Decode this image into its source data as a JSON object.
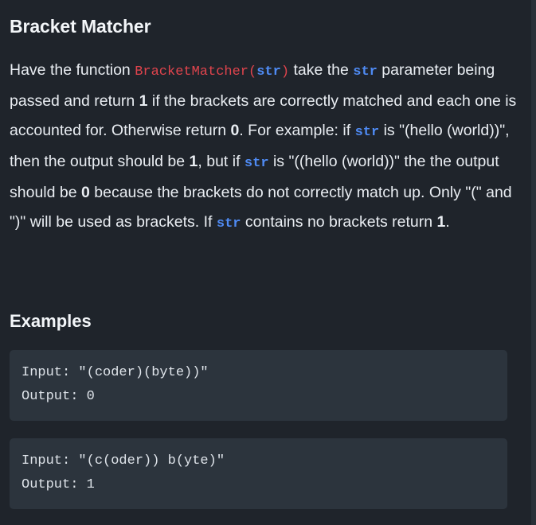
{
  "title": "Bracket Matcher",
  "description": {
    "t1": "Have the function ",
    "fn_name": "BracketMatcher",
    "paren_open": "(",
    "fn_arg": "str",
    "paren_close": ")",
    "t2": " take the ",
    "str1": "str",
    "t3": " parameter being passed and return ",
    "one1": "1",
    "t4": " if the brackets are correctly matched and each one is accounted for. Otherwise return ",
    "zero1": "0",
    "t5": ". For example: if ",
    "str2": "str",
    "t6": " is \"(hello (world))\", then the output should be ",
    "one2": "1",
    "t7": ", but if ",
    "str3": "str",
    "t8": " is \"((hello (world))\" the the output should be ",
    "zero2": "0",
    "t9": " because the brackets do not correctly match up. Only \"(\" and \")\" will be used as brackets. If ",
    "str4": "str",
    "t10": " contains no brackets return ",
    "one3": "1",
    "t11": "."
  },
  "examples_heading": "Examples",
  "examples": [
    {
      "input": "Input: \"(coder)(byte))\"",
      "output": "Output: 0"
    },
    {
      "input": "Input: \"(c(oder)) b(yte)\"",
      "output": "Output: 1"
    }
  ]
}
